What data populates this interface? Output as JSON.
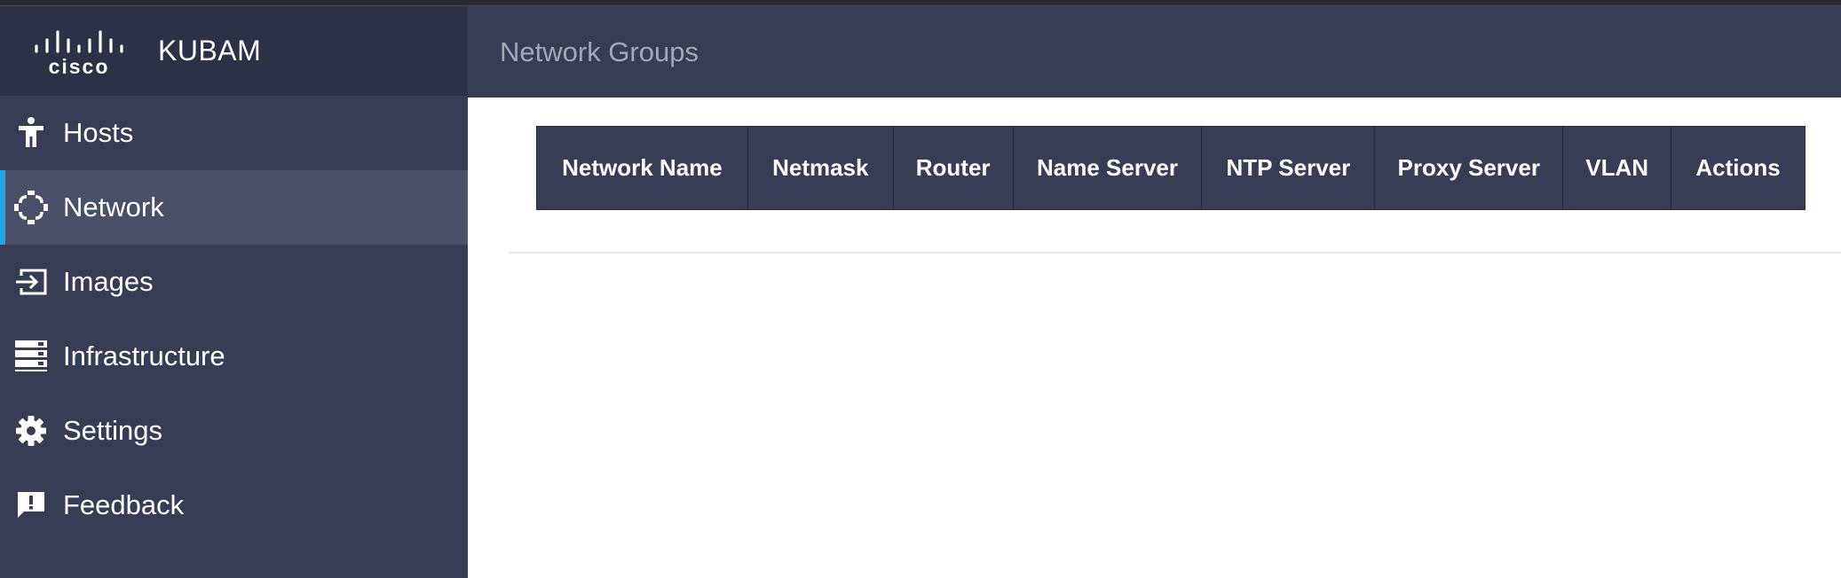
{
  "app": {
    "logo_text": "cisco",
    "title": "KUBAM"
  },
  "sidebar": {
    "items": [
      {
        "label": "Hosts",
        "icon": "accessibility-icon",
        "active": false
      },
      {
        "label": "Network",
        "icon": "network-icon",
        "active": true
      },
      {
        "label": "Images",
        "icon": "input-icon",
        "active": false
      },
      {
        "label": "Infrastructure",
        "icon": "server-rack-icon",
        "active": false
      },
      {
        "label": "Settings",
        "icon": "gear-icon",
        "active": false
      },
      {
        "label": "Feedback",
        "icon": "feedback-icon",
        "active": false
      }
    ]
  },
  "header": {
    "title": "Network Groups"
  },
  "table": {
    "columns": [
      "Network Name",
      "Netmask",
      "Router",
      "Name Server",
      "NTP Server",
      "Proxy Server",
      "VLAN",
      "Actions"
    ],
    "rows": []
  },
  "colors": {
    "sidebar_bg": "#373d55",
    "brand_bg": "#2c3147",
    "active_item_bg": "#4a5068",
    "active_accent": "#1ea6e6",
    "header_text": "#a3a8b7"
  }
}
